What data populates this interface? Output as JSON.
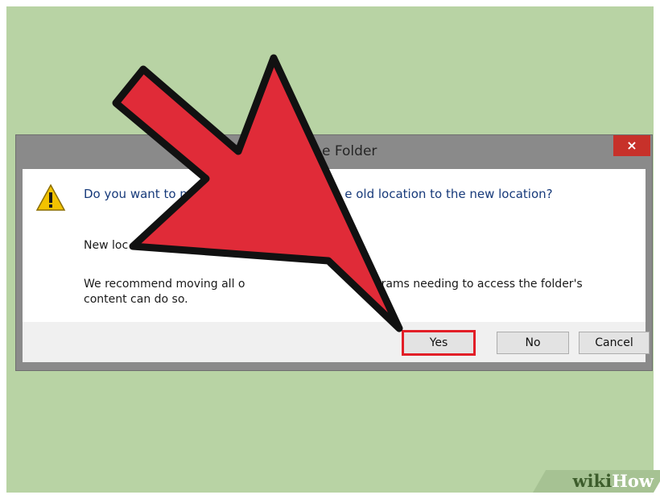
{
  "dialog": {
    "title": "e Folder",
    "close_label": "×",
    "message_main": "Do you want to mo                                      e old location to the new location?",
    "message_location": "New loc",
    "message_recommend_line1": "We recommend moving all o                                    grams needing to access the folder's",
    "message_recommend_line2": "content can do so.",
    "buttons": {
      "yes": "Yes",
      "no": "No",
      "cancel": "Cancel"
    }
  },
  "watermark": {
    "wiki": "wiki",
    "how": "How"
  },
  "colors": {
    "background": "#b8d3a4",
    "arrow_fill": "#e02b38",
    "highlight": "#e21e27",
    "close_button": "#c7312a"
  }
}
